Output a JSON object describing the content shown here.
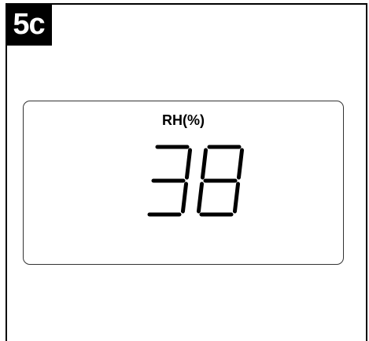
{
  "step": {
    "label": "5c"
  },
  "display": {
    "label": "RH(%)",
    "reading": "38"
  },
  "colors": {
    "badge_background": "#000000",
    "badge_text": "#ffffff",
    "segment": "#000000",
    "border": "#333333"
  }
}
